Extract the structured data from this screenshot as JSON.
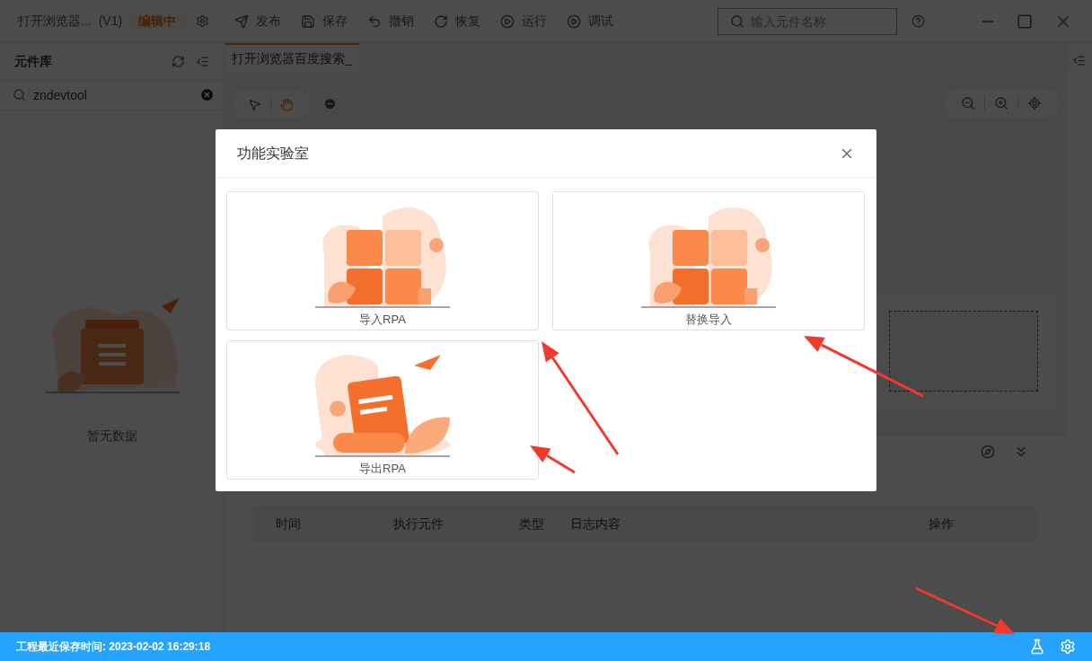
{
  "window": {
    "project_title": "打开浏览器...",
    "version": "(V1)",
    "status_badge": "编辑中"
  },
  "toolbar": [
    {
      "kind": "publish",
      "label": "发布"
    },
    {
      "kind": "save",
      "label": "保存"
    },
    {
      "kind": "undo",
      "label": "撤销"
    },
    {
      "kind": "redo",
      "label": "恢复"
    },
    {
      "kind": "run",
      "label": "运行"
    },
    {
      "kind": "debug",
      "label": "调试"
    }
  ],
  "search": {
    "placeholder": "输入元件名称"
  },
  "library": {
    "title": "元件库",
    "search_value": "zndevtool",
    "empty_text": "暂无数据"
  },
  "tabs": [
    {
      "label": "打开浏览器百度搜索_",
      "selected": true
    }
  ],
  "log_table": {
    "columns": [
      "时间",
      "执行元件",
      "类型",
      "日志内容",
      "操作"
    ]
  },
  "dialog": {
    "title": "功能实验室",
    "cards": [
      {
        "label": "导入RPA",
        "kind": "puzzle"
      },
      {
        "label": "替换导入",
        "kind": "puzzle"
      },
      {
        "label": "导出RPA",
        "kind": "export"
      }
    ]
  },
  "status_bar": {
    "text": "工程最近保存时间: 2023-02-02 16:29:18"
  }
}
